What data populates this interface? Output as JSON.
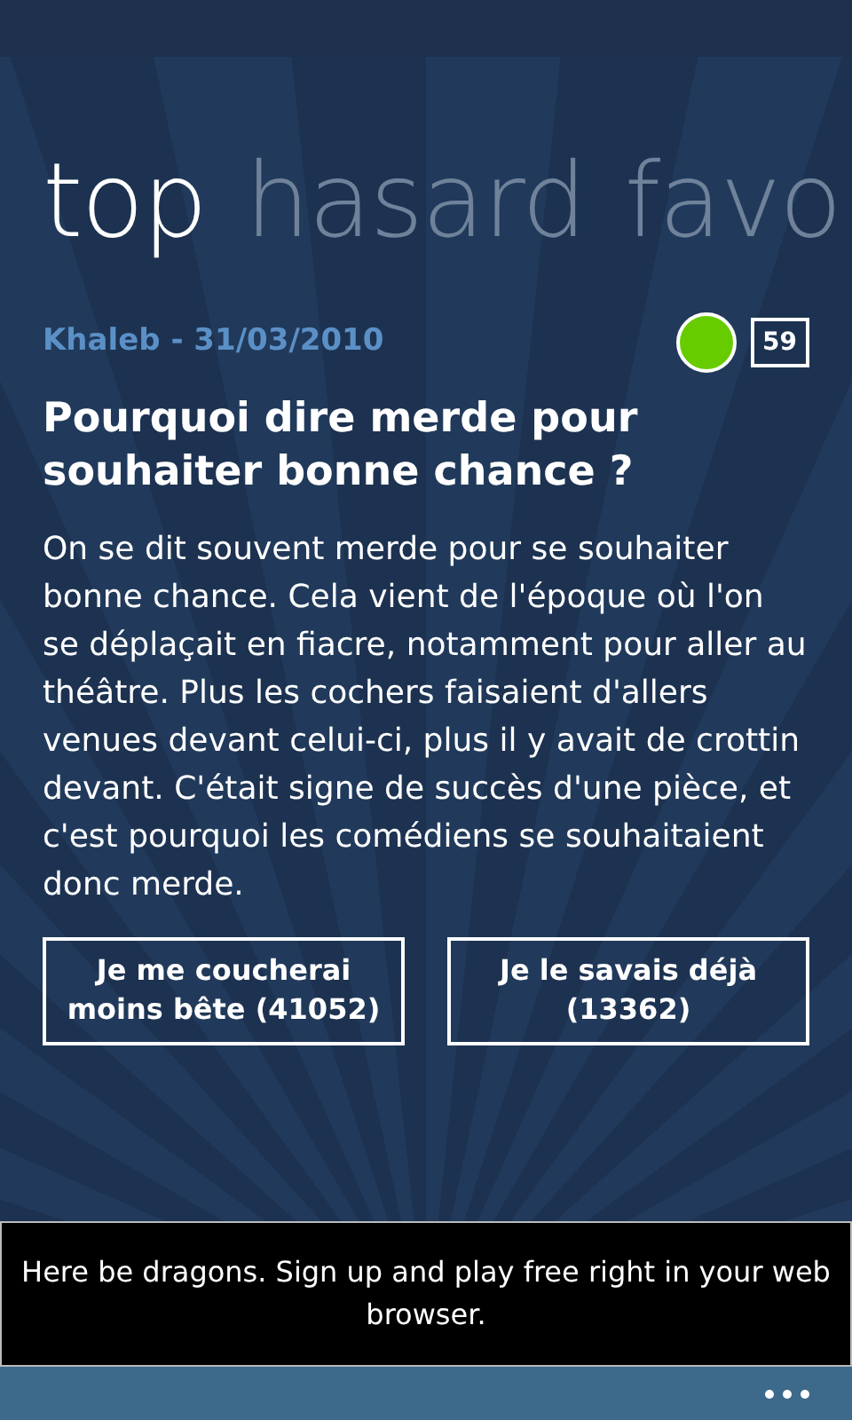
{
  "pivot": [
    {
      "label": "top",
      "selected": true
    },
    {
      "label": "hasard",
      "selected": false
    },
    {
      "label": "favo",
      "selected": false
    }
  ],
  "entry": {
    "author": "Khaleb",
    "separator": "-",
    "date": "31/03/2010",
    "color": "#66cc00",
    "comments": "59",
    "title": "Pourquoi dire merde pour souhaiter bonne chance ?",
    "body": "On se dit souvent merde pour se souhaiter bonne chance. Cela vient de l'époque où l'on se déplaçait en fiacre, notamment pour aller au théâtre. Plus les cochers faisaient d'allers venues devant celui-ci, plus il y avait de crottin devant. C'était signe de succès d'une pièce, et c'est pourquoi les comédiens se souhaitaient donc merde.",
    "buttons": [
      "Je me coucherai moins bête (41052)",
      "Je le savais déjà (13362)"
    ]
  },
  "ad": {
    "text": "Here be dragons. Sign up and play free right in your web browser."
  }
}
